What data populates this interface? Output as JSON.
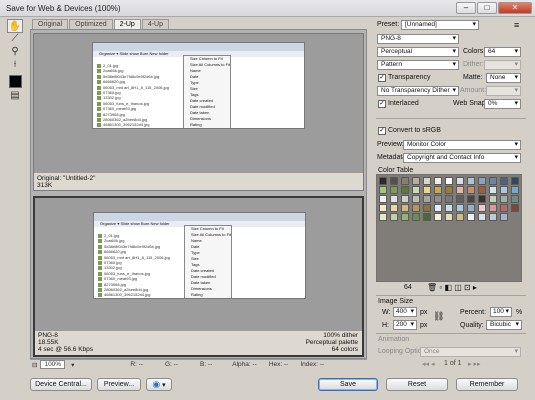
{
  "window": {
    "title": "Save for Web & Devices (100%)"
  },
  "tabs": [
    "Original",
    "Optimized",
    "2-Up",
    "4-Up"
  ],
  "panes": [
    {
      "line1": "Original: \"Untitled-2\"",
      "line2": "313K"
    },
    {
      "left1": "PNG-8",
      "left2": "18.55K",
      "left3": "4 sec @ 56.6 Kbps",
      "right1": "100% dither",
      "right2": "Perceptual palette",
      "right3": "64 colors"
    }
  ],
  "thumb": {
    "toolbar": "Organize ▾   Slide show   Burn   New folder",
    "files": [
      "2_01.jpg",
      "2cat60k.jpg",
      "5d38e8f043e7fd8c0e9f2d6b.jpg",
      "6666620.jpg",
      "06053_mnt art_8H1_8_115_2006.jpg",
      "07360.jpg",
      "13302.jpg",
      "06053_funs_e_thanos.jpg",
      "07360_meat93.jpg",
      "8273968.jpg",
      "28060362_a2bee8d4.jpg",
      "46861300_3962152d4.jpg"
    ],
    "menu": [
      "Size Column to Fit",
      "Size All Columns to Fit",
      "Name",
      "Date",
      "Type",
      "Size",
      "Tags",
      "Date created",
      "Date modified",
      "Date taken",
      "Dimensions",
      "Rating"
    ]
  },
  "infobar": {
    "zoom": "100%",
    "r": "R: --",
    "g": "G: --",
    "b": "B: --",
    "alpha": "Alpha: --",
    "hex": "Hex: --",
    "index": "Index: --"
  },
  "buttons": {
    "device_central": "Device Central...",
    "preview": "Preview...",
    "save": "Save",
    "reset": "Reset",
    "remember": "Remember"
  },
  "settings": {
    "preset_label": "Preset:",
    "preset_value": "[Unnamed]",
    "format": "PNG-8",
    "reduction": "Perceptual",
    "colors_label": "Colors:",
    "colors_value": "64",
    "dither_algo": "Pattern",
    "dither_label": "Dither:",
    "transparency_label": "Transparency",
    "matte_label": "Matte:",
    "matte_value": "None",
    "trans_dither": "No Transparency Dither",
    "amount_label": "Amount:",
    "interlaced_label": "Interlaced",
    "websnap_label": "Web Snap:",
    "websnap_value": "0%",
    "convert_label": "Convert to sRGB",
    "preview_label": "Preview:",
    "preview_value": "Monitor Color",
    "metadata_label": "Metadata:",
    "metadata_value": "Copyright and Contact Info",
    "color_table_label": "Color Table",
    "color_count": "64"
  },
  "image_size": {
    "label": "Image Size",
    "w_label": "W:",
    "w_value": "400",
    "h_label": "H:",
    "h_value": "200",
    "unit": "px",
    "percent_label": "Percent:",
    "percent_value": "100",
    "percent_unit": "%",
    "quality_label": "Quality:",
    "quality_value": "Bicubic"
  },
  "animation": {
    "label": "Animation",
    "looping_label": "Looping Options:",
    "looping_value": "Once",
    "frame": "1 of 1"
  },
  "palette": [
    "#2b2a28",
    "#55524c",
    "#8a7f6c",
    "#b8ae9a",
    "#dcd6c8",
    "#f2efe8",
    "#ffffff",
    "#d8dfe9",
    "#b3c1d3",
    "#8ea2bc",
    "#6e86a3",
    "#4d6480",
    "#324660",
    "#a8c47a",
    "#7f9c54",
    "#5b7a38",
    "#c9d8b0",
    "#e9d58c",
    "#c9a94f",
    "#9b7e34",
    "#e6b7a0",
    "#c98c6a",
    "#a05c3c",
    "#d6e4f2",
    "#a9c7e4",
    "#7aa6d2",
    "#f1f1f1",
    "#e2e2e2",
    "#cfcfcf",
    "#bcbcbc",
    "#a5a5a5",
    "#8f8f8f",
    "#787878",
    "#5f5f5f",
    "#474747",
    "#333333",
    "#c4d2b8",
    "#9cb2a4",
    "#6f8c84",
    "#f5e9c9",
    "#ead6a5",
    "#d5b97a",
    "#b99657",
    "#8f7140",
    "#e4eef8",
    "#cbdcec",
    "#b0c8e0",
    "#8fb0d0",
    "#f0c8c8",
    "#d89a9a",
    "#b86a6a",
    "#7e4444",
    "#dde9d0",
    "#bcd4a4",
    "#93b474",
    "#6a8e4c",
    "#4a6c34",
    "#f7f0d8",
    "#e8dcb4",
    "#d0bd88",
    "#edf2f7",
    "#d5e0ea",
    "#bccbd9",
    "#a2b5c8"
  ]
}
